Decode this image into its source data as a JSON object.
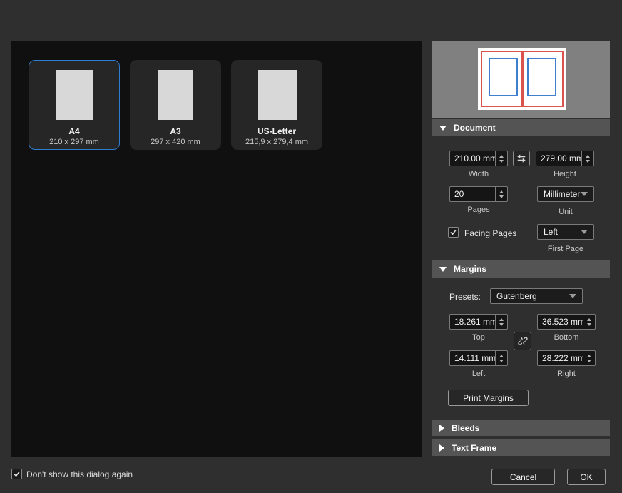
{
  "templates": [
    {
      "name": "A4",
      "size": "210 x 297 mm",
      "selected": true
    },
    {
      "name": "A3",
      "size": "297 x 420 mm",
      "selected": false
    },
    {
      "name": "US-Letter",
      "size": "215,9 x 279,4 mm",
      "selected": false
    }
  ],
  "sections": {
    "document": {
      "label": "Document",
      "expanded": true
    },
    "margins": {
      "label": "Margins",
      "expanded": true
    },
    "bleeds": {
      "label": "Bleeds",
      "expanded": false
    },
    "text_frame": {
      "label": "Text Frame",
      "expanded": false
    }
  },
  "document": {
    "width": {
      "value": "210.00 mm",
      "label": "Width"
    },
    "height": {
      "value": "279.00 mm",
      "label": "Height"
    },
    "pages": {
      "value": "20",
      "label": "Pages"
    },
    "unit": {
      "value": "Millimeter",
      "label": "Unit"
    },
    "facing_pages": {
      "label": "Facing Pages",
      "checked": true
    },
    "first_page": {
      "value": "Left",
      "label": "First Page"
    }
  },
  "margins": {
    "presets_label": "Presets:",
    "presets_value": "Gutenberg",
    "top": {
      "value": "18.261 mm",
      "label": "Top"
    },
    "bottom": {
      "value": "36.523 mm",
      "label": "Bottom"
    },
    "left": {
      "value": "14.111 mm",
      "label": "Left"
    },
    "right": {
      "value": "28.222 mm",
      "label": "Right"
    },
    "print_margins_label": "Print Margins"
  },
  "footer": {
    "dont_show_label": "Don't show this dialog again",
    "dont_show_checked": true,
    "cancel_label": "Cancel",
    "ok_label": "OK"
  },
  "colors": {
    "accent_blue": "#2e7dd1",
    "preview_page_red": "#d9544d",
    "preview_margin_blue": "#3f7fce",
    "preview_background": "#808080",
    "panel_background": "#101010",
    "dialog_background": "#2f2f2f",
    "section_header_background": "#545454"
  },
  "icons": {
    "section_expanded": "triangle-down",
    "section_collapsed": "triangle-right",
    "size_swap": "swap-arrows",
    "margins_link": "broken-chain",
    "checkbox_check": "check",
    "dropdown_arrow": "triangle-down",
    "spinner": "up-down-triangles"
  }
}
